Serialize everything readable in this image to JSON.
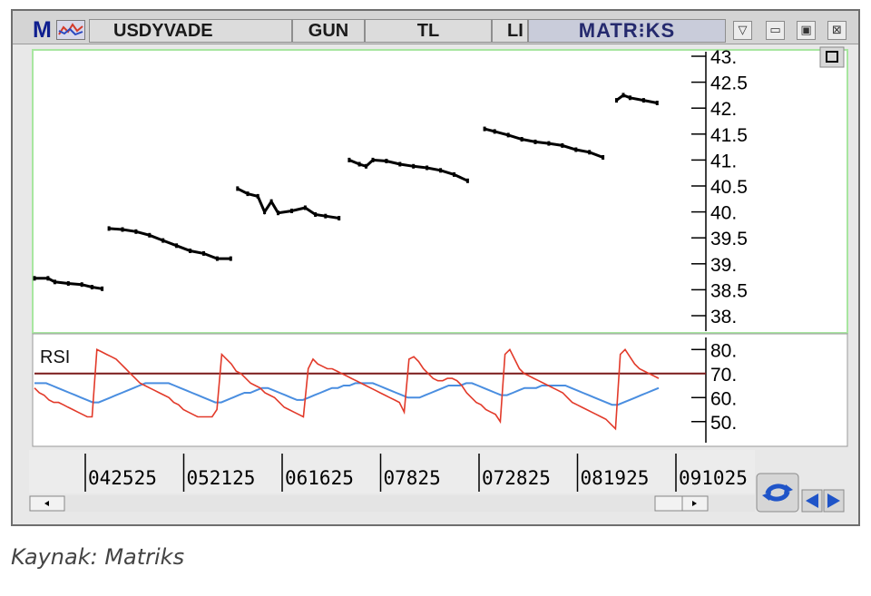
{
  "window": {
    "menu_letter": "M",
    "symbol": "USDYVADE",
    "period": "GUN",
    "currency": "TL",
    "clipped_field": "LI",
    "logo": "MATR⁝KS",
    "icons": [
      "chart-type-icon",
      "dropdown-icon",
      "minimize-icon",
      "maximize-icon",
      "close-icon",
      "panel-expand-icon",
      "refresh-icon",
      "scroll-left-icon",
      "scroll-right-icon"
    ]
  },
  "caption": "Kaynak: Matriks",
  "colors": {
    "price": "#000000",
    "rsi": "#e23a2a",
    "rsi_average": "#4a8ee0",
    "level_line": "#7a1a1a",
    "frame_green": "#a8e6a0"
  },
  "chart_data": [
    {
      "type": "line",
      "title": "",
      "ylabel": "",
      "ylim": [
        38,
        43
      ],
      "yticks": [
        "38.",
        "38.5",
        "39.",
        "39.5",
        "40.",
        "40.5",
        "41.",
        "41.5",
        "42.",
        "42.5",
        "43."
      ],
      "xticks": [
        "042525",
        "052125",
        "061625",
        "07825",
        "072825",
        "081925",
        "091025"
      ],
      "series": [
        {
          "segments": [
            [
              [
                0,
                38.72
              ],
              [
                4,
                38.72
              ],
              [
                6,
                38.65
              ],
              [
                10,
                38.62
              ],
              [
                14,
                38.6
              ],
              [
                17,
                38.55
              ],
              [
                20,
                38.52
              ]
            ],
            [
              [
                22,
                39.68
              ],
              [
                26,
                39.66
              ],
              [
                30,
                39.62
              ],
              [
                34,
                39.55
              ],
              [
                38,
                39.45
              ],
              [
                42,
                39.35
              ],
              [
                46,
                39.25
              ],
              [
                50,
                39.2
              ],
              [
                54,
                39.1
              ],
              [
                58,
                39.1
              ]
            ],
            [
              [
                60,
                40.45
              ],
              [
                63,
                40.35
              ],
              [
                66,
                40.3
              ],
              [
                68,
                40.0
              ],
              [
                70,
                40.2
              ],
              [
                72,
                39.98
              ],
              [
                76,
                40.02
              ],
              [
                80,
                40.08
              ],
              [
                83,
                39.95
              ],
              [
                86,
                39.92
              ],
              [
                90,
                39.88
              ]
            ],
            [
              [
                93,
                41.0
              ],
              [
                96,
                40.92
              ],
              [
                98,
                40.88
              ],
              [
                100,
                41.0
              ],
              [
                104,
                40.98
              ],
              [
                108,
                40.92
              ],
              [
                112,
                40.88
              ],
              [
                116,
                40.85
              ],
              [
                120,
                40.8
              ],
              [
                124,
                40.72
              ],
              [
                128,
                40.6
              ]
            ],
            [
              [
                133,
                41.6
              ],
              [
                136,
                41.55
              ],
              [
                140,
                41.48
              ],
              [
                144,
                41.4
              ],
              [
                148,
                41.35
              ],
              [
                152,
                41.32
              ],
              [
                156,
                41.28
              ],
              [
                160,
                41.2
              ],
              [
                164,
                41.15
              ],
              [
                168,
                41.05
              ]
            ],
            [
              [
                172,
                42.15
              ],
              [
                174,
                42.25
              ],
              [
                176,
                42.2
              ],
              [
                180,
                42.15
              ],
              [
                184,
                42.1
              ]
            ]
          ]
        }
      ]
    },
    {
      "type": "line",
      "title": "RSI",
      "ylim": [
        45,
        82
      ],
      "yticks": [
        "50.",
        "60.",
        "70.",
        "80."
      ],
      "reference_line": 70,
      "series": [
        {
          "values": [
            64,
            62,
            61,
            59,
            58,
            58,
            57,
            56,
            55,
            54,
            53,
            52,
            52,
            80,
            79,
            78,
            77,
            76,
            74,
            72,
            70,
            68,
            66,
            65,
            64,
            63,
            62,
            61,
            60,
            58,
            57,
            55,
            54,
            53,
            52,
            52,
            52,
            52,
            55,
            78,
            76,
            74,
            71,
            70,
            68,
            66,
            65,
            64,
            62,
            61,
            60,
            58,
            56,
            55,
            54,
            53,
            52,
            72,
            76,
            74,
            73,
            72,
            72,
            71,
            70,
            69,
            68,
            67,
            66,
            65,
            64,
            63,
            62,
            61,
            60,
            59,
            58,
            54,
            76,
            77,
            75,
            72,
            70,
            68,
            67,
            67,
            68,
            68,
            67,
            65,
            62,
            60,
            58,
            57,
            55,
            54,
            53,
            50,
            78,
            80,
            76,
            72,
            70,
            69,
            68,
            67,
            66,
            65,
            64,
            63,
            62,
            60,
            58,
            57,
            56,
            55,
            54,
            53,
            52,
            51,
            49,
            47,
            78,
            80,
            77,
            74,
            72,
            71,
            70,
            69,
            68
          ]
        },
        {
          "values": [
            66,
            66,
            66,
            65,
            64,
            63,
            62,
            61,
            60,
            59,
            58,
            58,
            59,
            60,
            61,
            62,
            63,
            64,
            65,
            66,
            66,
            66,
            66,
            66,
            65,
            64,
            63,
            62,
            61,
            60,
            59,
            58,
            58,
            59,
            60,
            61,
            62,
            62,
            63,
            64,
            64,
            63,
            62,
            61,
            60,
            59,
            59,
            60,
            61,
            62,
            63,
            64,
            64,
            65,
            65,
            66,
            66,
            66,
            66,
            65,
            64,
            63,
            62,
            61,
            60,
            60,
            60,
            61,
            62,
            63,
            64,
            65,
            65,
            65,
            66,
            66,
            65,
            64,
            63,
            62,
            61,
            61,
            62,
            63,
            64,
            64,
            64,
            65,
            65,
            65,
            65,
            65,
            64,
            63,
            62,
            61,
            60,
            59,
            58,
            57,
            57,
            58,
            59,
            60,
            61,
            62,
            63,
            64
          ]
        }
      ]
    }
  ]
}
